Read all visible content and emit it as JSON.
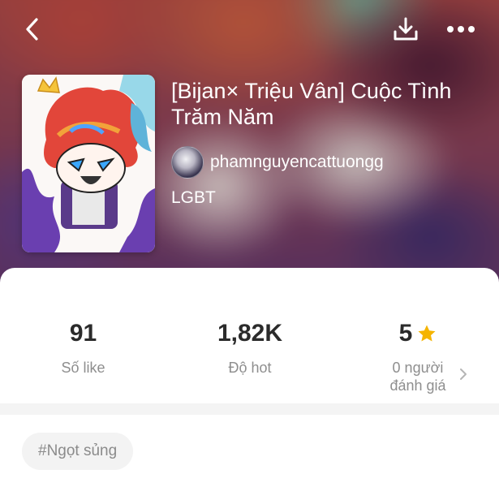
{
  "header": {
    "back_icon": "chevron-left-icon",
    "download_icon": "download-icon",
    "more_icon": "more-horizontal-icon"
  },
  "story": {
    "title": "[Bijan× Triệu Vân] Cuộc Tình Trăm Năm",
    "author": "phamnguyencattuongg",
    "genre": "LGBT"
  },
  "stats": {
    "likes": {
      "value": "91",
      "label": "Số like"
    },
    "hot": {
      "value": "1,82K",
      "label": "Độ hot"
    },
    "rating": {
      "value": "5",
      "label_line1": "0 người",
      "label_line2": "đánh giá",
      "star_color": "#f5b400"
    }
  },
  "tags": [
    {
      "label": "#Ngọt sủng"
    }
  ],
  "colors": {
    "text_primary": "#2b2b2b",
    "text_secondary": "#8e8e8e",
    "tag_bg": "#f3f3f3"
  }
}
